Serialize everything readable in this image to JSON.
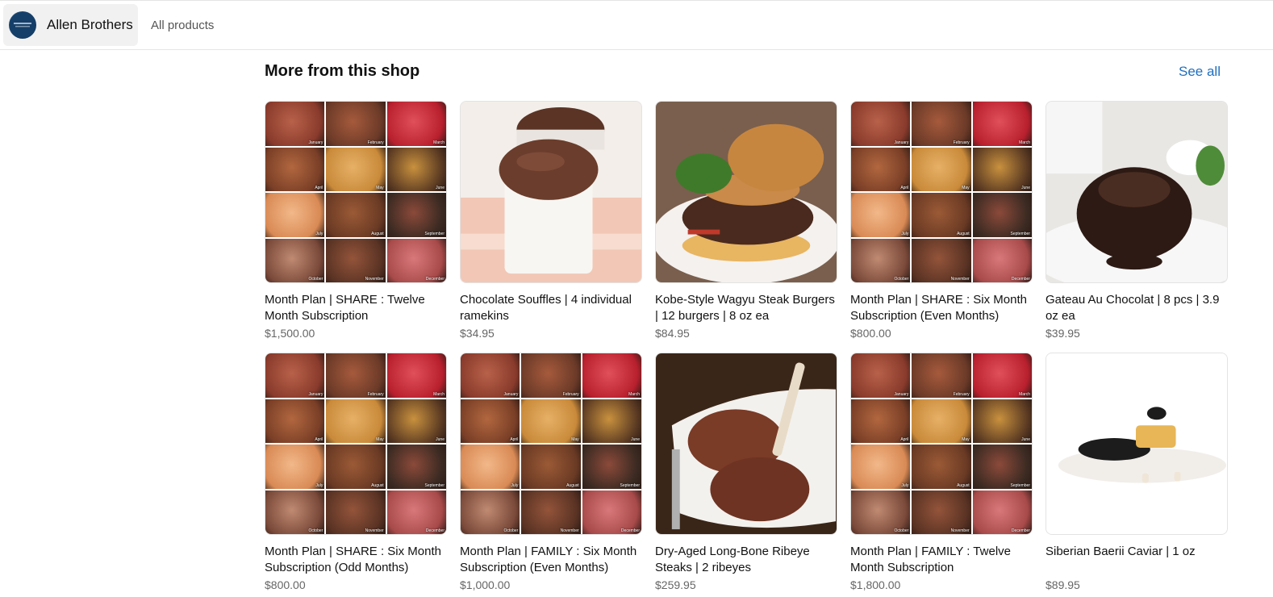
{
  "header": {
    "shop_name": "Allen Brothers",
    "all_products": "All products",
    "logo_icon": "allen-brothers-logo-icon"
  },
  "section": {
    "title": "More from this shop",
    "see_all": "See all"
  },
  "products": [
    {
      "title": "Month Plan | SHARE : Twelve Month Subscription",
      "price": "$1,500.00",
      "image": "collage"
    },
    {
      "title": "Chocolate Souffles | 4 individual ramekins",
      "price": "$34.95",
      "image": "souffle"
    },
    {
      "title": "Kobe-Style Wagyu Steak Burgers | 12 burgers | 8 oz ea",
      "price": "$84.95",
      "image": "burger"
    },
    {
      "title": "Month Plan | SHARE : Six Month Subscription (Even Months)",
      "price": "$800.00",
      "image": "collage"
    },
    {
      "title": "Gateau Au Chocolat | 8 pcs | 3.9 oz ea",
      "price": "$39.95",
      "image": "cake"
    },
    {
      "title": "Month Plan | SHARE : Six Month Subscription (Odd Months)",
      "price": "$800.00",
      "image": "collage"
    },
    {
      "title": "Month Plan | FAMILY : Six Month Subscription (Even Months)",
      "price": "$1,000.00",
      "image": "collage"
    },
    {
      "title": "Dry-Aged Long-Bone Ribeye Steaks | 2 ribeyes",
      "price": "$259.95",
      "image": "ribeye"
    },
    {
      "title": "Month Plan | FAMILY : Twelve Month Subscription",
      "price": "$1,800.00",
      "image": "collage"
    },
    {
      "title": "Siberian Baerii Caviar | 1 oz",
      "price": "$89.95",
      "image": "caviar"
    }
  ],
  "collage_months": [
    "January",
    "February",
    "March",
    "April",
    "May",
    "June",
    "July",
    "August",
    "September",
    "October",
    "November",
    "December"
  ]
}
